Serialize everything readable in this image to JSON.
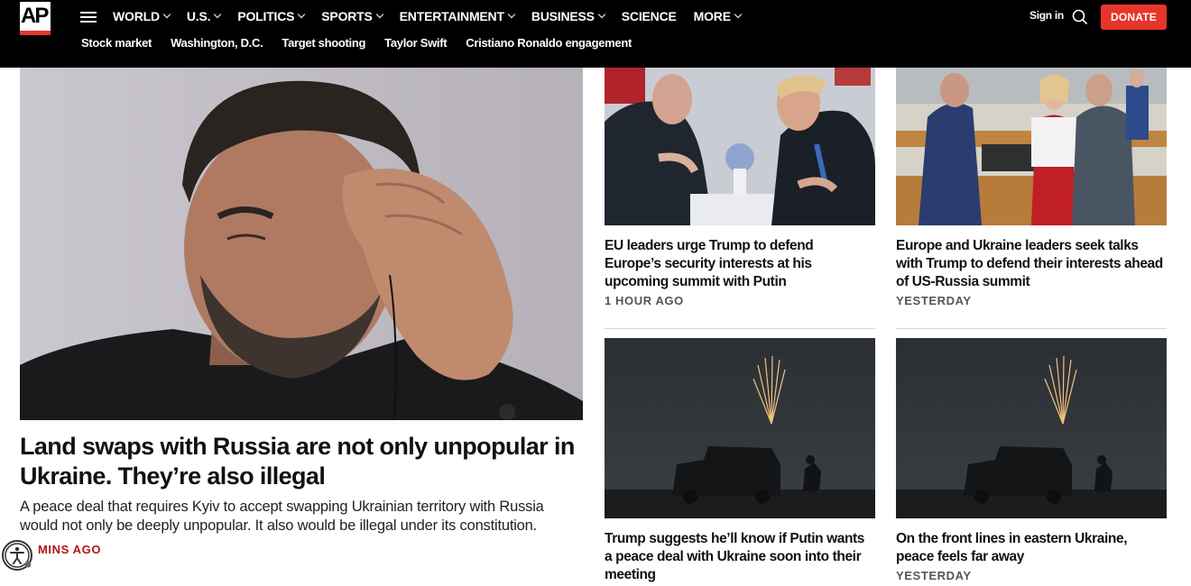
{
  "header": {
    "logo_text": "AP",
    "nav": [
      {
        "label": "WORLD",
        "has_menu": true
      },
      {
        "label": "U.S.",
        "has_menu": true
      },
      {
        "label": "POLITICS",
        "has_menu": true
      },
      {
        "label": "SPORTS",
        "has_menu": true
      },
      {
        "label": "ENTERTAINMENT",
        "has_menu": true
      },
      {
        "label": "BUSINESS",
        "has_menu": true
      },
      {
        "label": "SCIENCE",
        "has_menu": false
      },
      {
        "label": "MORE",
        "has_menu": true
      }
    ],
    "trending": [
      "Stock market",
      "Washington, D.C.",
      "Target shooting",
      "Taylor Swift",
      "Cristiano Ronaldo engagement"
    ],
    "signin_label": "Sign in",
    "donate_label": "DONATE",
    "accent_color": "#e7352b"
  },
  "lead": {
    "headline": "Land swaps with Russia are not only unpopular in Ukraine. They’re also illegal",
    "summary": "A peace deal that requires Kyiv to accept swapping Ukrainian territory with Russia would not only be deeply unpopular. It also would be illegal under its constitution.",
    "timestamp": "MINS AGO"
  },
  "stories": [
    {
      "title": "EU leaders urge Trump to defend Europe’s security interests at his upcoming summit with Putin",
      "timestamp": "1 HOUR AGO"
    },
    {
      "title": "Europe and Ukraine leaders seek talks with Trump to defend their interests ahead of US-Russia summit",
      "timestamp": "YESTERDAY"
    },
    {
      "title": "Trump suggests he’ll know if Putin wants a peace deal with Ukraine soon into their meeting",
      "timestamp": ""
    },
    {
      "title": "On the front lines in eastern Ukraine, peace feels far away",
      "timestamp": "YESTERDAY"
    }
  ]
}
